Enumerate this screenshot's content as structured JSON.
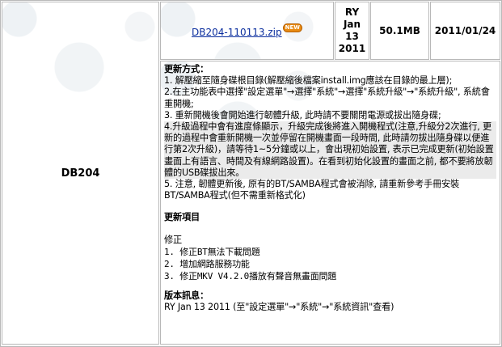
{
  "row": {
    "model": "DB204",
    "file_link": "DB204-110113.zip",
    "new_badge": "NEW",
    "version_lines": [
      "RY",
      "Jan",
      "13",
      "2011"
    ],
    "size": "50.1MB",
    "date": "2011/01/24"
  },
  "notes": {
    "update_method_heading": "更新方式：",
    "steps": [
      "1. 解壓縮至隨身碟根目錄(解壓縮後檔案install.img應該在目錄的最上層);",
      "2.在主功能表中選擇\"設定選單\"→選擇\"系統\"→選擇\"系統升級\"→\"系統升級\", 系統會重開機;",
      "3. 重新開機後會開始進行韌體升級, 此時請不要關閉電源或拔出隨身碟;",
      "4.升級過程中會有進度條顯示，升級完成後將進入開機程式(注意,升級分2次進行, 更新的過程中會重新開機一次並停留在開機畫面一段時間, 此時請勿拔出隨身碟以便進行第2次升級)，請等待1~5分鐘或以上，會出現初始設置, 表示已完成更新(初始設置畫面上有語言、時間及有線網路設置)。在看到初始化設置的畫面之前, 都不要將放韌體的USB碟拔出來。",
      "5. 注意, 韌體更新後, 原有的BT/SAMBA程式會被消除, 請重新參考手冊安裝BT/SAMBA程式(但不需重新格式化)"
    ],
    "update_items_heading": "更新項目",
    "fix_label": "修正",
    "fixes": [
      "1. 修正BT無法下載問題",
      "2. 增加網路服務功能",
      "3. 修正MKV V4.2.0播放有聲音無畫面問題"
    ],
    "version_info_heading": "版本訊息：",
    "version_info": "RY Jan 13  2011  (至\"設定選單\"→\"系統\"→\"系統資訊\"查看)"
  },
  "colors": {
    "link": "#0b2e9e",
    "border": "#b8b8b8",
    "badge": "#e88a12"
  }
}
